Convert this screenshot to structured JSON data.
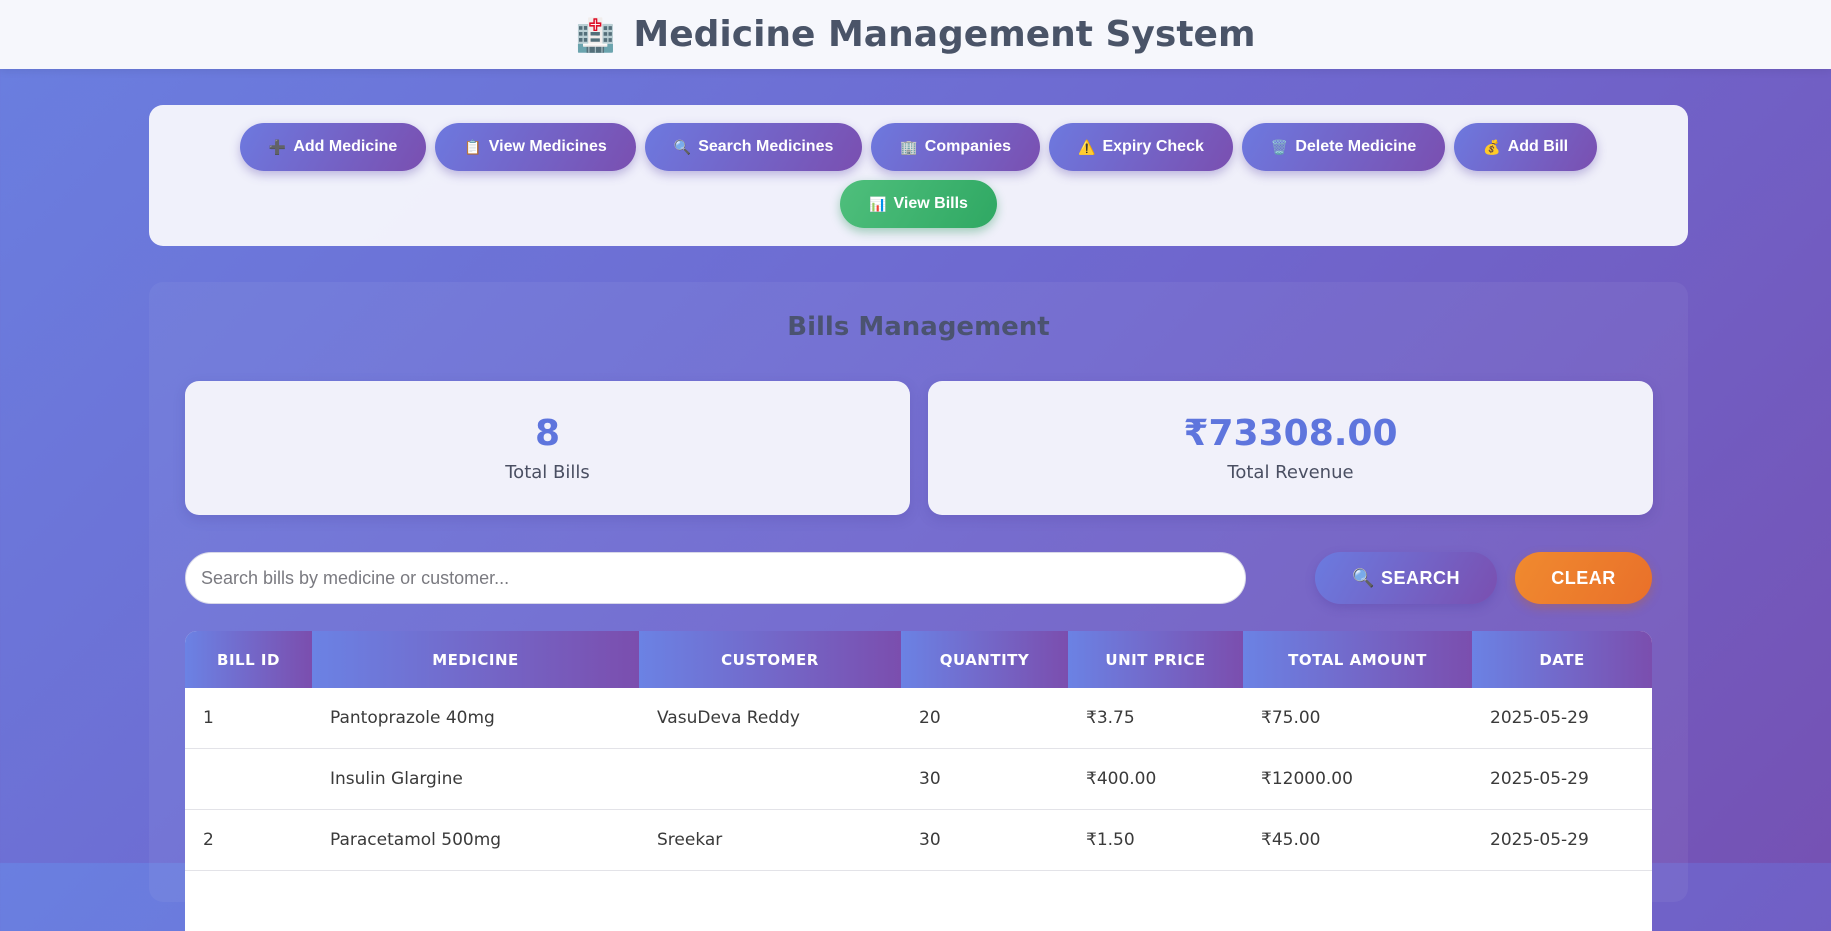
{
  "header": {
    "icon": "🏥",
    "title": "Medicine Management System"
  },
  "nav": {
    "buttons": [
      {
        "icon": "➕",
        "label": "Add Medicine"
      },
      {
        "icon": "📋",
        "label": "View Medicines"
      },
      {
        "icon": "🔍",
        "label": "Search Medicines"
      },
      {
        "icon": "🏢",
        "label": "Companies"
      },
      {
        "icon": "⚠️",
        "label": "Expiry Check"
      },
      {
        "icon": "🗑️",
        "label": "Delete Medicine"
      },
      {
        "icon": "💰",
        "label": "Add Bill"
      },
      {
        "icon": "📊",
        "label": "View Bills"
      }
    ],
    "active": "View Bills"
  },
  "bills": {
    "title": "Bills Management",
    "stats": {
      "total_bills": {
        "value": "8",
        "label": "Total Bills"
      },
      "total_revenue": {
        "value": "₹73308.00",
        "label": "Total Revenue"
      }
    },
    "search": {
      "placeholder": "Search bills by medicine or customer...",
      "value": "",
      "search_icon": "🔍",
      "search_label": "SEARCH",
      "clear_label": "CLEAR"
    },
    "table": {
      "columns": [
        "BILL ID",
        "MEDICINE",
        "CUSTOMER",
        "QUANTITY",
        "UNIT PRICE",
        "TOTAL AMOUNT",
        "DATE"
      ],
      "rows": [
        [
          "1",
          "Pantoprazole 40mg",
          "VasuDeva Reddy",
          "20",
          "₹3.75",
          "₹75.00",
          "2025-05-29"
        ],
        [
          "",
          "Insulin Glargine",
          "",
          "30",
          "₹400.00",
          "₹12000.00",
          "2025-05-29"
        ],
        [
          "2",
          "Paracetamol 500mg",
          "Sreekar",
          "30",
          "₹1.50",
          "₹45.00",
          "2025-05-29"
        ]
      ]
    }
  }
}
